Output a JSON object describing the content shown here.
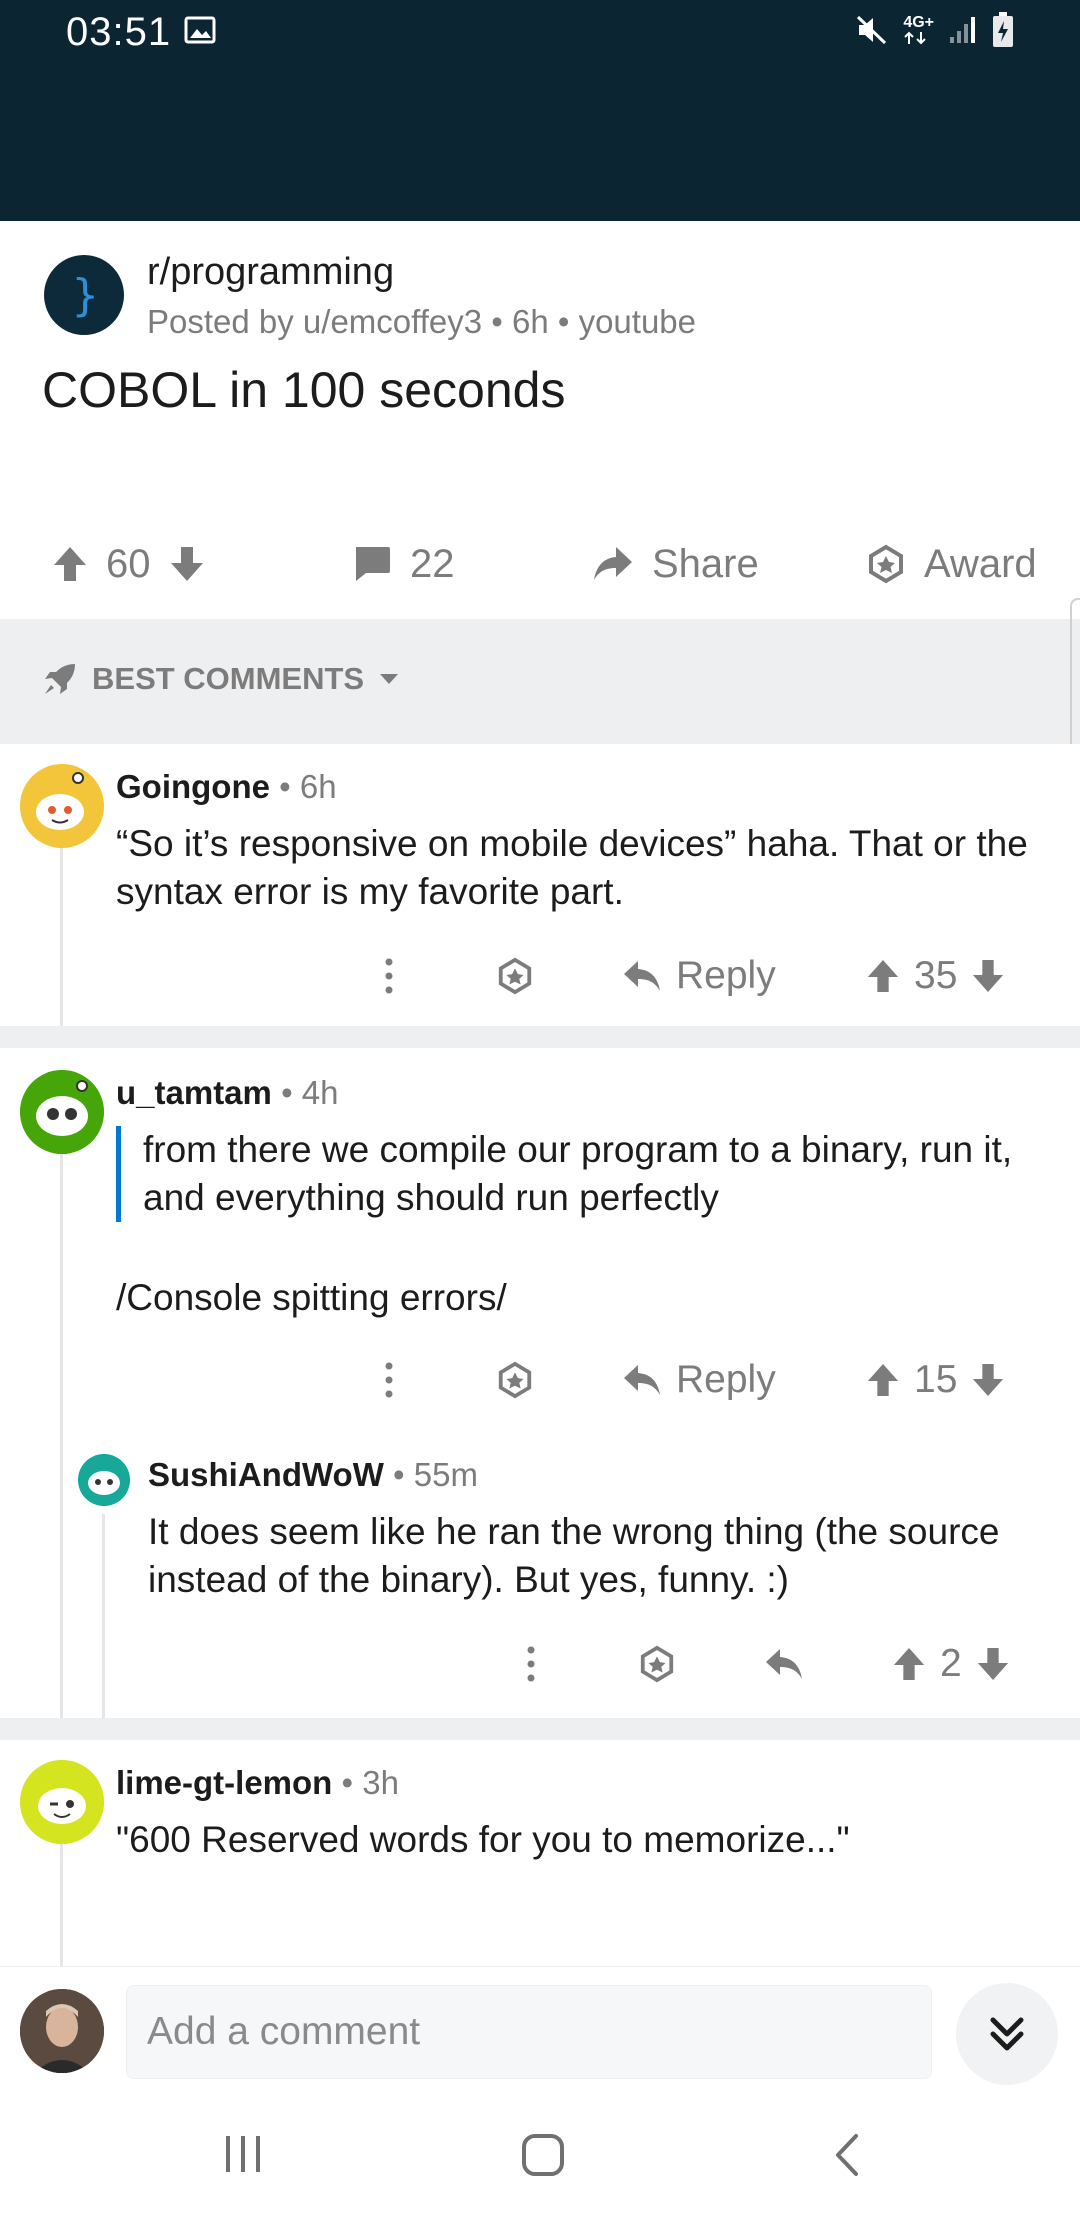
{
  "status_bar": {
    "time": "03:51",
    "network": "4G+"
  },
  "post": {
    "subreddit": "r/programming",
    "meta": "Posted by u/emcoffey3 • 6h • youtube",
    "title": "COBOL in 100 seconds",
    "upvotes": "60",
    "comments": "22",
    "share_label": "Share",
    "award_label": "Award"
  },
  "sort": {
    "label": "BEST COMMENTS"
  },
  "comments": [
    {
      "author": "Goingone",
      "time": "6h",
      "body": "“So it’s responsive on mobile devices” haha. That or the syntax error is my favorite part.",
      "reply_label": "Reply",
      "score": "35"
    },
    {
      "author": "u_tamtam",
      "time": "4h",
      "quote": "from there we compile our program to a binary, run it, and everything should run perfectly",
      "body": "/Console spitting errors/",
      "reply_label": "Reply",
      "score": "15"
    },
    {
      "author": "SushiAndWoW",
      "time": "55m",
      "body": "It does seem like he ran the wrong thing (the source instead of the binary). But yes, funny. :)",
      "score": "2"
    },
    {
      "author": "lime-gt-lemon",
      "time": "3h",
      "body": "\"600 Reserved words for you to memorize...\""
    }
  ],
  "composer": {
    "placeholder": "Add a comment"
  },
  "colors": {
    "status_bar": "#0b2533",
    "accent_blue": "#0079d3",
    "gray_text": "#7c7c7c",
    "divider": "#edeff1"
  }
}
